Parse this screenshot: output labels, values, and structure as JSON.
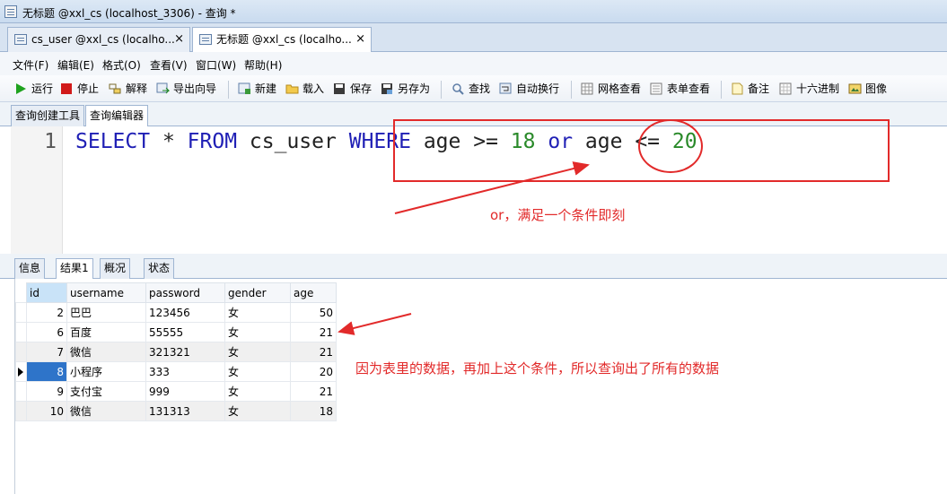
{
  "window": {
    "title": "无标题 @xxl_cs (localhost_3306) - 查询 *"
  },
  "doc_tabs": [
    {
      "label": "cs_user @xxl_cs (localho...",
      "close": "×"
    },
    {
      "label": "无标题 @xxl_cs (localho...",
      "close": "×"
    }
  ],
  "menu": [
    "文件(F)",
    "编辑(E)",
    "格式(O)",
    "查看(V)",
    "窗口(W)",
    "帮助(H)"
  ],
  "toolbar": {
    "run": "运行",
    "stop": "停止",
    "explain": "解释",
    "export": "导出向导",
    "new": "新建",
    "load": "载入",
    "save": "保存",
    "save_as": "另存为",
    "find": "查找",
    "wrap": "自动换行",
    "grid_view": "网格查看",
    "form_view": "表单查看",
    "note": "备注",
    "hex": "十六进制",
    "image": "图像"
  },
  "sub_tabs": [
    "查询创建工具",
    "查询编辑器"
  ],
  "editor": {
    "line_number": "1",
    "tokens": {
      "select": "SELECT",
      "star": "*",
      "from": "FROM",
      "table": "cs_user",
      "where": "WHERE",
      "col1": "age",
      "op1": ">=",
      "val1": "18",
      "or": "or",
      "col2": "age",
      "op2": "<=",
      "val2": "20"
    }
  },
  "result_tabs": [
    "信息",
    "结果1",
    "概况",
    "状态"
  ],
  "grid": {
    "columns": [
      "id",
      "username",
      "password",
      "gender",
      "age"
    ],
    "rows": [
      [
        "2",
        "巴巴",
        "123456",
        "女",
        "50"
      ],
      [
        "6",
        "百度",
        "55555",
        "女",
        "21"
      ],
      [
        "7",
        "微信",
        "321321",
        "女",
        "21"
      ],
      [
        "8",
        "小程序",
        "333",
        "女",
        "20"
      ],
      [
        "9",
        "支付宝",
        "999",
        "女",
        "21"
      ],
      [
        "10",
        "微信",
        "131313",
        "女",
        "18"
      ]
    ],
    "selected_row_index": 3
  },
  "annotations": {
    "or_note": "or，满足一个条件即刻",
    "data_note": "因为表里的数据，再加上这个条件，所以查询出了所有的数据"
  },
  "colors": {
    "annotation": "#e22a2a",
    "keyword": "#1f1fb5",
    "number": "#2a8a2a",
    "selection": "#2e74c9"
  }
}
